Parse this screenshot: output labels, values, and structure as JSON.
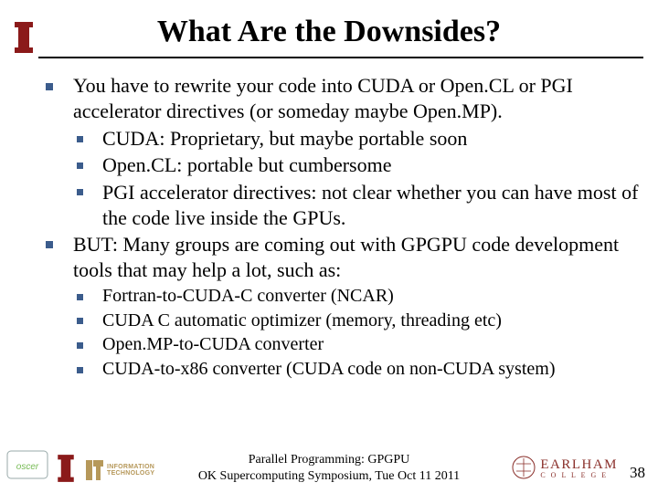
{
  "title": "What Are the Downsides?",
  "bullets": [
    {
      "text": "You have to rewrite your code into CUDA or Open.CL or PGI accelerator directives (or someday maybe Open.MP).",
      "sub": [
        "CUDA: Proprietary, but maybe portable soon",
        "Open.CL: portable but cumbersome",
        "PGI accelerator directives: not clear whether you can have most of the code live inside the GPUs."
      ]
    },
    {
      "text": "BUT: Many groups are coming out with GPGPU code development tools that may help a lot, such as:",
      "sub_small": true,
      "sub": [
        "Fortran-to-CUDA-C converter (NCAR)",
        "CUDA C automatic optimizer (memory, threading etc)",
        "Open.MP-to-CUDA converter",
        "CUDA-to-x86 converter (CUDA code on non-CUDA system)"
      ]
    }
  ],
  "footer": {
    "line1": "Parallel Programming: GPGPU",
    "line2": "OK Supercomputing Symposium, Tue Oct 11 2011"
  },
  "page_number": "38",
  "logos": {
    "ou_color": "#8b1a1a",
    "earlham_name": "EARLHAM",
    "earlham_sub": "C O L L E G E",
    "it_line1": "INFORMATION",
    "it_line2": "TECHNOLOGY",
    "oscer": "oscer"
  }
}
